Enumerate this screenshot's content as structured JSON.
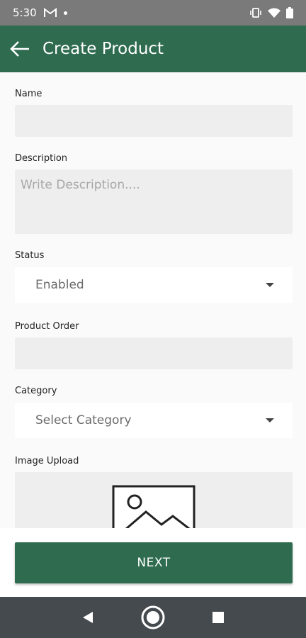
{
  "status_bar": {
    "time": "5:30",
    "gmail_icon": "gmail-icon",
    "vibrate_icon": "vibrate-icon",
    "wifi_icon": "wifi-icon",
    "battery_icon": "battery-icon"
  },
  "app_bar": {
    "title": "Create Product",
    "back_icon": "arrow-back-icon",
    "background_color": "#2e6b4f"
  },
  "form": {
    "name": {
      "label": "Name",
      "value": ""
    },
    "description": {
      "label": "Description",
      "placeholder": "Write Description...."
    },
    "status": {
      "label": "Status",
      "selected": "Enabled"
    },
    "product_order": {
      "label": "Product Order",
      "value": ""
    },
    "category": {
      "label": "Category",
      "selected": "Select Category"
    },
    "image_upload": {
      "label": "Image Upload",
      "icon": "image-placeholder-icon"
    }
  },
  "actions": {
    "next_label": "NEXT"
  },
  "nav_bar": {
    "back_icon": "nav-back-icon",
    "home_icon": "nav-home-icon",
    "recents_icon": "nav-recents-icon"
  }
}
